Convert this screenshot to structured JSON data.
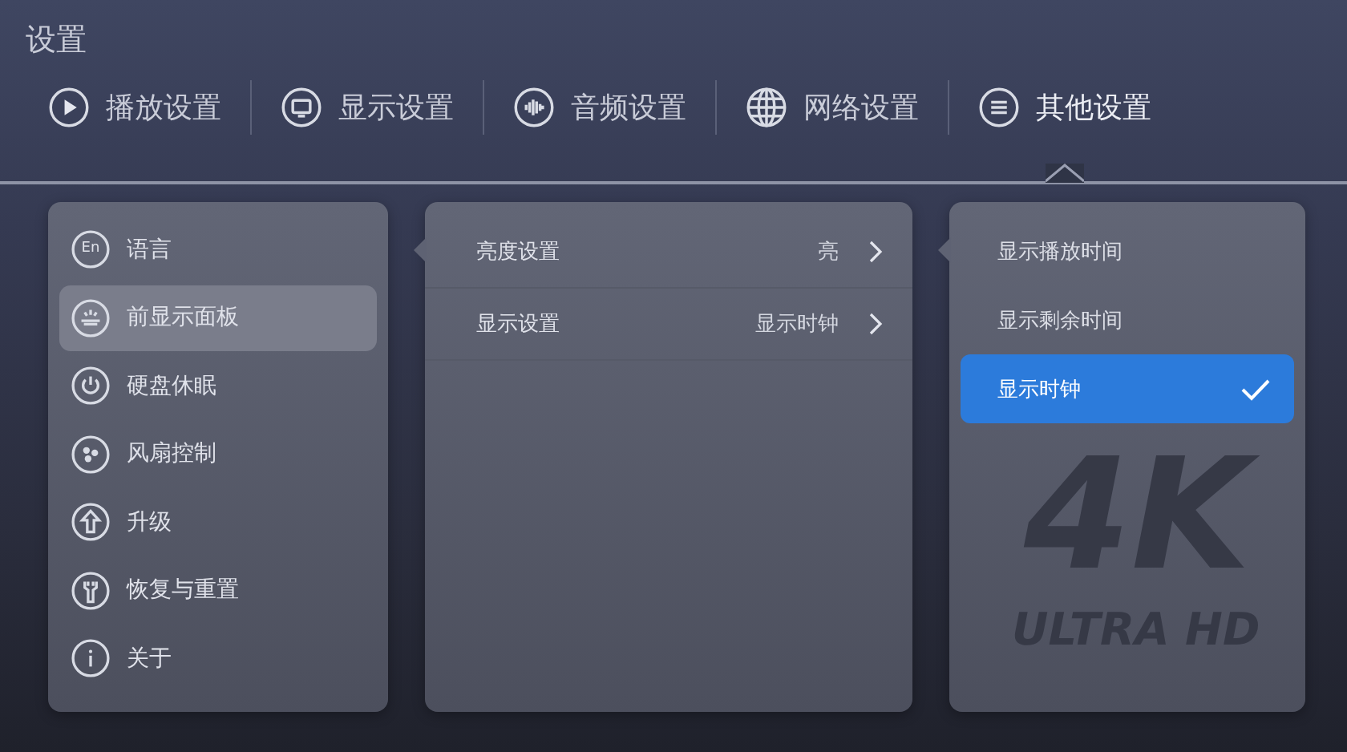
{
  "window": {
    "title": "设置"
  },
  "tabs": [
    {
      "label": "播放设置",
      "selected": false
    },
    {
      "label": "显示设置",
      "selected": false
    },
    {
      "label": "音频设置",
      "selected": false
    },
    {
      "label": "网络设置",
      "selected": false
    },
    {
      "label": "其他设置",
      "selected": true
    }
  ],
  "sidebar": {
    "items": [
      {
        "label": "语言",
        "icon_text": "En",
        "selected": false
      },
      {
        "label": "前显示面板",
        "selected": true
      },
      {
        "label": "硬盘休眠",
        "selected": false
      },
      {
        "label": "风扇控制",
        "selected": false
      },
      {
        "label": "升级",
        "selected": false
      },
      {
        "label": "恢复与重置",
        "selected": false
      },
      {
        "label": "关于",
        "selected": false
      }
    ]
  },
  "settings": [
    {
      "label": "亮度设置",
      "value": "亮"
    },
    {
      "label": "显示设置",
      "value": "显示时钟"
    }
  ],
  "options": [
    {
      "label": "显示播放时间",
      "selected": false
    },
    {
      "label": "显示剩余时间",
      "selected": false
    },
    {
      "label": "显示时钟",
      "selected": true
    }
  ],
  "background_logo": {
    "mark": "4K",
    "caption": "ULTRA HD"
  }
}
